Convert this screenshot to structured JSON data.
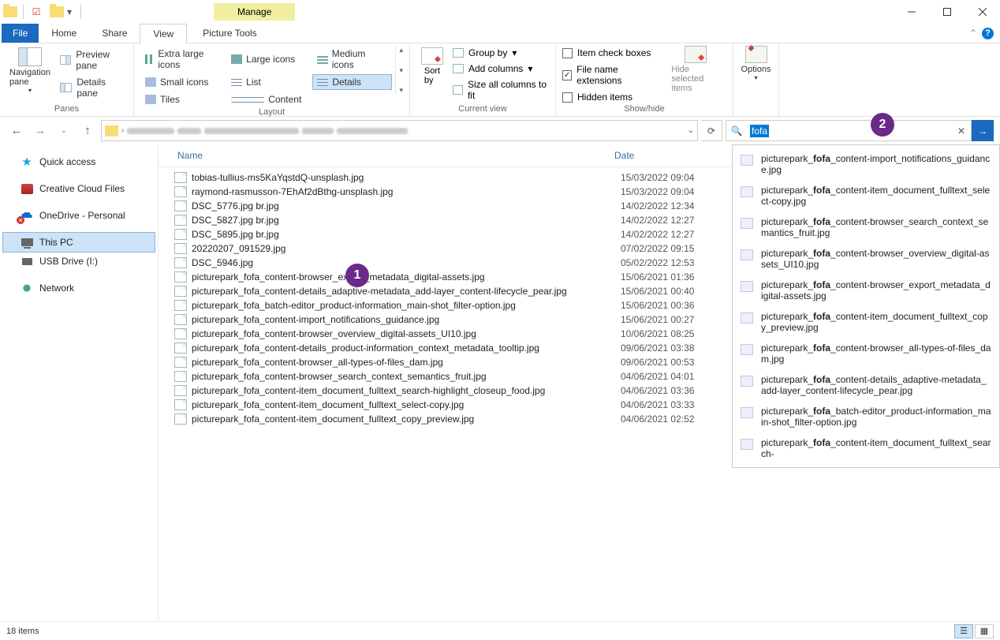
{
  "titlebar": {
    "manage": "Manage",
    "picture_tools": "Picture Tools"
  },
  "tabs": {
    "file": "File",
    "home": "Home",
    "share": "Share",
    "view": "View"
  },
  "ribbon": {
    "panes": {
      "nav": "Navigation\npane",
      "preview": "Preview pane",
      "details": "Details pane",
      "group": "Panes"
    },
    "layout": {
      "xl": "Extra large icons",
      "lg": "Large icons",
      "md": "Medium icons",
      "sm": "Small icons",
      "list": "List",
      "details": "Details",
      "tiles": "Tiles",
      "content": "Content",
      "group": "Layout"
    },
    "current": {
      "sort": "Sort\nby",
      "group_by": "Group by",
      "add_cols": "Add columns",
      "size_all": "Size all columns to fit",
      "group": "Current view"
    },
    "show": {
      "item_check": "Item check boxes",
      "file_ext": "File name extensions",
      "hidden": "Hidden items",
      "hide_sel": "Hide selected\nitems",
      "options": "Options",
      "group": "Show/hide"
    },
    "checks": {
      "file_ext": "✓"
    }
  },
  "search": {
    "query": "fofa",
    "results": [
      "picturepark_fofa_content-import_notifications_guidance.jpg",
      "picturepark_fofa_content-item_document_fulltext_select-copy.jpg",
      "picturepark_fofa_content-browser_search_context_semantics_fruit.jpg",
      "picturepark_fofa_content-browser_overview_digital-assets_UI10.jpg",
      "picturepark_fofa_content-browser_export_metadata_digital-assets.jpg",
      "picturepark_fofa_content-item_document_fulltext_copy_preview.jpg",
      "picturepark_fofa_content-browser_all-types-of-files_dam.jpg",
      "picturepark_fofa_content-details_adaptive-metadata_add-layer_content-lifecycle_pear.jpg",
      "picturepark_fofa_batch-editor_product-information_main-shot_filter-option.jpg",
      "picturepark_fofa_content-item_document_fulltext_search-"
    ]
  },
  "sidebar": {
    "quick": "Quick access",
    "cc": "Creative Cloud Files",
    "onedrive": "OneDrive - Personal",
    "pc": "This PC",
    "usb": "USB Drive (I:)",
    "network": "Network"
  },
  "columns": {
    "name": "Name",
    "date": "Date"
  },
  "files": [
    {
      "n": "tobias-tullius-ms5KaYqstdQ-unsplash.jpg",
      "d": "15/03/2022 09:04"
    },
    {
      "n": "raymond-rasmusson-7EhAf2dBthg-unsplash.jpg",
      "d": "15/03/2022 09:04"
    },
    {
      "n": "DSC_5776.jpg br.jpg",
      "d": "14/02/2022 12:34"
    },
    {
      "n": "DSC_5827.jpg br.jpg",
      "d": "14/02/2022 12:27"
    },
    {
      "n": "DSC_5895.jpg br.jpg",
      "d": "14/02/2022 12:27"
    },
    {
      "n": "20220207_091529.jpg",
      "d": "07/02/2022 09:15"
    },
    {
      "n": "DSC_5946.jpg",
      "d": "05/02/2022 12:53"
    },
    {
      "n": "picturepark_fofa_content-browser_export_metadata_digital-assets.jpg",
      "d": "15/06/2021 01:36"
    },
    {
      "n": "picturepark_fofa_content-details_adaptive-metadata_add-layer_content-lifecycle_pear.jpg",
      "d": "15/06/2021 00:40"
    },
    {
      "n": "picturepark_fofa_batch-editor_product-information_main-shot_filter-option.jpg",
      "d": "15/06/2021 00:36"
    },
    {
      "n": "picturepark_fofa_content-import_notifications_guidance.jpg",
      "d": "15/06/2021 00:27"
    },
    {
      "n": "picturepark_fofa_content-browser_overview_digital-assets_UI10.jpg",
      "d": "10/06/2021 08:25"
    },
    {
      "n": "picturepark_fofa_content-details_product-information_context_metadata_tooltip.jpg",
      "d": "09/06/2021 03:38"
    },
    {
      "n": "picturepark_fofa_content-browser_all-types-of-files_dam.jpg",
      "d": "09/06/2021 00:53"
    },
    {
      "n": "picturepark_fofa_content-browser_search_context_semantics_fruit.jpg",
      "d": "04/06/2021 04:01"
    },
    {
      "n": "picturepark_fofa_content-item_document_fulltext_search-highlight_closeup_food.jpg",
      "d": "04/06/2021 03:36"
    },
    {
      "n": "picturepark_fofa_content-item_document_fulltext_select-copy.jpg",
      "d": "04/06/2021 03:33"
    },
    {
      "n": "picturepark_fofa_content-item_document_fulltext_copy_preview.jpg",
      "d": "04/06/2021 02:52"
    }
  ],
  "status": {
    "count": "18 items"
  },
  "badges": {
    "one": "1",
    "two": "2"
  }
}
